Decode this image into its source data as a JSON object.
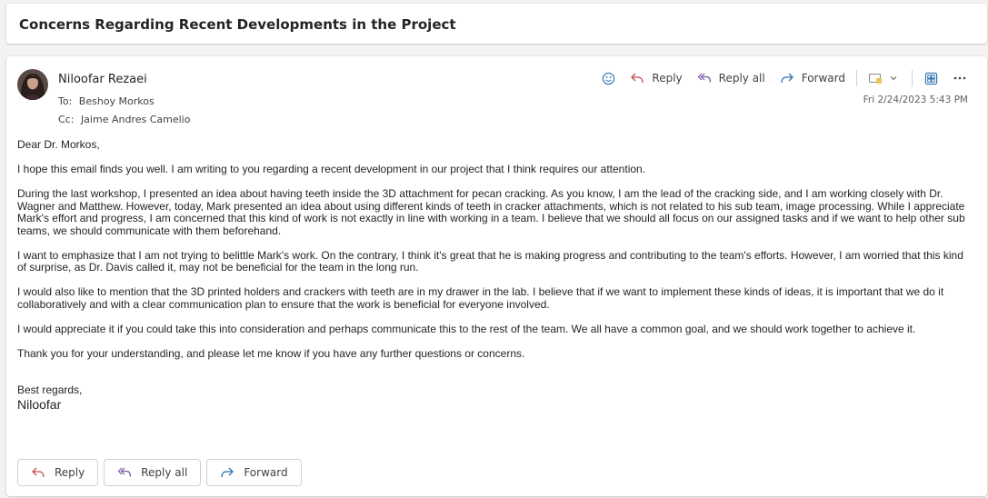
{
  "subject": "Concerns Regarding Recent Developments in the Project",
  "message": {
    "sender_name": "Niloofar Rezaei",
    "to_label": "To:",
    "to_value": "Beshoy Morkos",
    "cc_label": "Cc:",
    "cc_value": "Jaime Andres Camelio",
    "date": "Fri 2/24/2023 5:43 PM",
    "body": [
      "Dear Dr. Morkos,",
      "I hope this email finds you well. I am writing to you regarding a recent development in our project that I think requires our attention.",
      "During the last workshop, I presented an idea about having teeth inside the 3D attachment for pecan cracking. As you know, I am the lead of the cracking side, and I am working closely with Dr. Wagner and Matthew. However, today, Mark presented an idea about using different kinds of teeth in cracker attachments, which is not related to his sub team, image processing. While I appreciate Mark's effort and progress, I am concerned that this kind of work is not exactly in line with working in a team. I believe that we should all focus on our assigned tasks and if we want to help other sub teams, we should communicate with them beforehand.",
      "I want to emphasize that I am not trying to belittle Mark's work. On the contrary, I think it's great that he is making progress and contributing to the team's efforts. However, I am worried that this kind of surprise, as Dr. Davis called it, may not be beneficial for the team in the long run.",
      "I would also like to mention that the 3D printed holders and crackers with teeth are in my drawer in the lab. I believe that if we want to implement these kinds of ideas, it is important that we do it collaboratively and with a clear communication plan to ensure that the work is beneficial for everyone involved.",
      "I would appreciate it if you could take this into consideration and perhaps communicate this to the rest of the team. We all have a common goal, and we should work together to achieve it.",
      "Thank you for your understanding, and please let me know if you have any further questions or concerns."
    ],
    "closing": "Best regards,",
    "signature": "Niloofar"
  },
  "toolbar": {
    "reply": "Reply",
    "reply_all": "Reply all",
    "forward": "Forward"
  },
  "reply_bar": {
    "reply": "Reply",
    "reply_all": "Reply all",
    "forward": "Forward"
  },
  "colors": {
    "accent": "#0f6cbd",
    "reply_icon": "#c05050",
    "reply_all_icon": "#7a5aa6",
    "forward_icon": "#2f6fb0"
  },
  "icons": [
    "emoji-icon",
    "reply-icon",
    "reply-all-icon",
    "forward-icon",
    "tag-icon",
    "chevron-down-icon",
    "immersive-reader-icon",
    "more-icon"
  ]
}
